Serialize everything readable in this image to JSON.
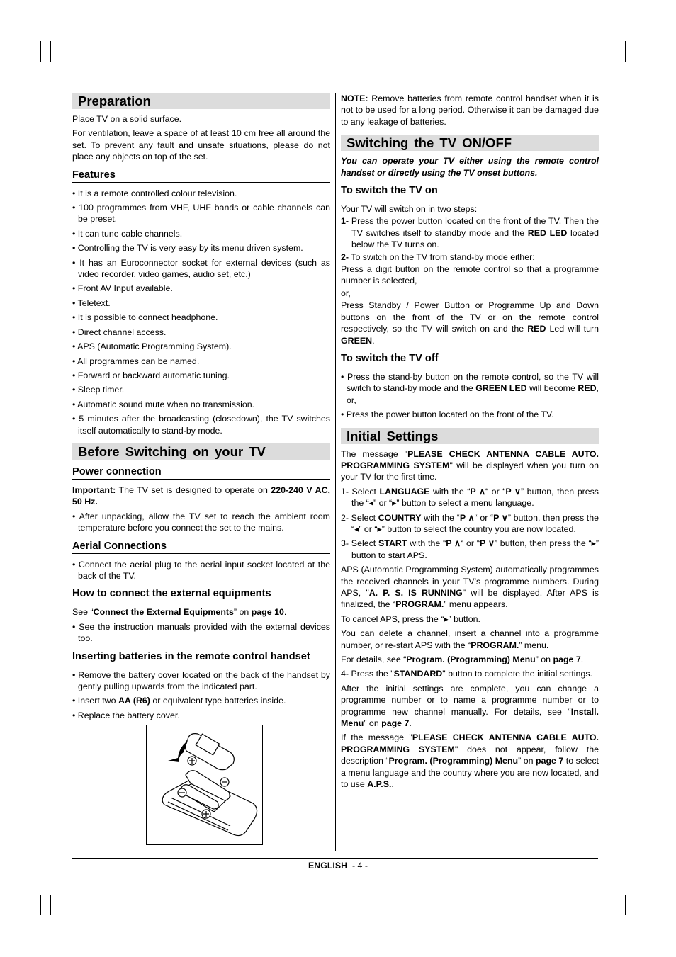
{
  "left_column": {
    "preparation": {
      "title": "Preparation",
      "paragraphs": [
        "Place TV on a solid surface.",
        "For ventilation, leave a space of at least 10 cm free all around the set. To prevent any fault and unsafe situations, please do not place any objects on top of the set."
      ]
    },
    "features": {
      "title": "Features",
      "items": [
        "It is a remote controlled colour television.",
        "100 programmes from VHF, UHF bands or cable channels can be preset.",
        "It can tune cable channels.",
        "Controlling the TV is very easy by its menu driven system.",
        "It has an Euroconnector socket for external devices (such as video recorder, video games, audio set, etc.)",
        "Front AV  Input available.",
        "Teletext.",
        "It is possible to connect headphone.",
        "Direct channel access.",
        "APS (Automatic Programming System).",
        "All programmes can be named.",
        "Forward or backward automatic tuning.",
        "Sleep timer.",
        "Automatic sound mute when no transmission.",
        "5 minutes after the broadcasting (closedown), the TV switches itself automatically to stand-by mode."
      ]
    },
    "before_switching": {
      "title": "Before Switching on your TV",
      "power": {
        "title": "Power connection",
        "important_label": "Important:",
        "important_text": " The TV set is designed to operate on ",
        "important_value": "220-240 V AC, 50 Hz.",
        "item": "After unpacking, allow the TV set to reach the ambient room temperature before you connect the set to the mains."
      },
      "aerial": {
        "title": "Aerial Connections",
        "item": "Connect the aerial plug to the aerial input socket located at the back of the TV."
      },
      "external": {
        "title": "How to connect the external equipments",
        "see_prefix": "See “",
        "see_bold": "Connect the External Equipments",
        "see_mid": "” on ",
        "see_page": "page 10",
        "see_end": ".",
        "item": "See the instruction manuals provided with the external devices too."
      },
      "batteries": {
        "title": "Inserting batteries in the remote control handset",
        "item1": "Remove the battery cover located on the back of the handset by gently pulling upwards from the indicated part.",
        "item2_prefix": "Insert two ",
        "item2_bold": "AA (R6)",
        "item2_suffix": " or equivalent type batteries inside.",
        "item3": "Replace the battery cover."
      }
    }
  },
  "right_column": {
    "note": {
      "label": "NOTE:",
      "text": " Remove batteries from remote control handset when it is not to be used for a long period. Otherwise it can be damaged due to any leakage of batteries."
    },
    "switching": {
      "title": "Switching the TV ON/OFF",
      "lead": "You can operate your TV either using the remote control handset or directly using the TV onset buttons.",
      "on": {
        "title": "To switch the TV on",
        "intro": "Your TV will switch on in two steps:",
        "step1_num": "1-",
        "step1_text": " Press the power button located on the front of the TV. Then the TV switches itself to standby mode and the ",
        "step1_bold": "RED LED",
        "step1_end": " located below the TV turns on.",
        "step2_num": "2-",
        "step2_text": " To switch on the TV from stand-by mode either:",
        "digit": "Press a digit button on the remote control so that a programme number is selected,",
        "or": "or,",
        "standby_text": "Press Standby / Power Button or Programme Up and Down buttons on the front of the TV or on the remote control respectively, so the TV will switch on and the ",
        "standby_red": "RED",
        "standby_mid": " Led will turn ",
        "standby_green": "GREEN",
        "standby_end": "."
      },
      "off": {
        "title": "To switch the TV off",
        "item1_text": "Press the stand-by button on the remote control, so the TV will switch to stand-by mode and the ",
        "item1_green": "GREEN LED",
        "item1_mid": " will become ",
        "item1_red": "RED",
        "item1_end": ",    or,",
        "item2": "Press the power button located on the front of the TV."
      }
    },
    "initial": {
      "title": "Initial Settings",
      "msg_prefix": "The message \"",
      "msg_bold": "PLEASE CHECK ANTENNA CABLE AUTO. PROGRAMMING SYSTEM",
      "msg_suffix": "\" will be displayed when you turn on your TV for the first time.",
      "step1_a": "1- Select ",
      "step1_b": "LANGUAGE",
      "step1_c": " with the “",
      "p_up": "P ∧",
      "step1_d": "“ or “",
      "p_down": "P ∨",
      "step1_e": "” button, then press the “◂” or “▸” button to select a menu language.",
      "step2_a": "2- Select ",
      "step2_b": "COUNTRY",
      "step2_c": " with the “",
      "step2_d": "“ or “",
      "step2_e": "” button, then press the “◂” or “▸” button to select the country you are now located.",
      "step3_a": "3- Select ",
      "step3_b": "START",
      "step3_c": " with the “",
      "step3_d": "“ or “",
      "step3_e": "” button, then press the “▸” button to start APS.",
      "aps_a": "APS (Automatic Programming System) automatically programmes the received channels in your TV’s programme numbers. During APS, \"",
      "aps_b": "A. P. S. IS RUNNING",
      "aps_c": "\" will be displayed. After APS is finalized, the “",
      "aps_d": "PROGRAM.",
      "aps_e": "” menu appears.",
      "cancel": "To cancel APS, press the “▸” button.",
      "delete_a": "You can delete a channel, insert a channel into a programme number, or re-start APS with the “",
      "delete_b": "PROGRAM.",
      "delete_c": "” menu.",
      "details_a": "For details, see “",
      "details_b": "Program. (Programming) Menu",
      "details_c": "” on ",
      "details_d": "page 7",
      "details_e": ".",
      "step4_a": "4- Press the \"",
      "step4_b": "STANDARD",
      "step4_c": "\" button to complete the initial settings.",
      "after_a": "After the initial settings are complete, you can change a programme number or to name a programme number or to programme new channel manually. For details, see “",
      "after_b": "Install. Menu",
      "after_c": "” on ",
      "after_d": "page 7",
      "after_e": ".",
      "ifmsg_a": "If the message \"",
      "ifmsg_b": "PLEASE CHECK ANTENNA CABLE AUTO. PROGRAMMING SYSTEM",
      "ifmsg_c": "\" does not appear, follow the description “",
      "ifmsg_d": "Program. (Programming) Menu",
      "ifmsg_e": "” on ",
      "ifmsg_f": "page 7",
      "ifmsg_g": " to select a menu language and the country where you are now located, and to use ",
      "ifmsg_h": "A.P.S.",
      "ifmsg_i": "."
    }
  },
  "footer": {
    "language": "ENGLISH",
    "page": "  - 4 -"
  }
}
